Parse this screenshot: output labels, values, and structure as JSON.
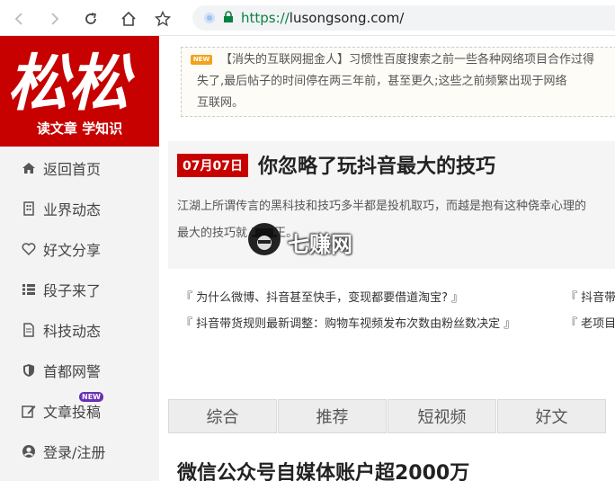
{
  "browser": {
    "url_scheme": "https://",
    "url_rest": "lusongsong.com/"
  },
  "sidebar": {
    "logo_text": "松松",
    "tagline": "读文章 学知识",
    "items": [
      {
        "label": "返回首页",
        "icon": "home-icon"
      },
      {
        "label": "业界动态",
        "icon": "building-icon"
      },
      {
        "label": "好文分享",
        "icon": "heart-icon"
      },
      {
        "label": "段子来了",
        "icon": "list-icon"
      },
      {
        "label": "科技动态",
        "icon": "document-icon"
      },
      {
        "label": "首都网警",
        "icon": "shield-icon"
      },
      {
        "label": "文章投稿",
        "icon": "edit-icon",
        "badge": "NEW"
      },
      {
        "label": "登录/注册",
        "icon": "user-icon"
      }
    ]
  },
  "notice": {
    "badge": "NEW",
    "line1": "【消失的互联网掘金人】习惯性百度搜索之前一些各种网络项目合作过得",
    "line2": "失了,最后帖子的时间停在两三年前，甚至更久;这些之前频繁出现于网络",
    "line3": "互联网。"
  },
  "feature": {
    "date": "07月07日",
    "title": "你忽略了玩抖音最大的技巧",
    "desc_line1": "江湖上所谓传言的黑科技和技巧多半都是投机取巧，而越是抱有这种侥幸心理的",
    "desc_line2": "最大的技巧就         容为王。"
  },
  "links": {
    "row1_left": "『 为什么微博、抖音甚至快手，变现都要借道淘宝? 』",
    "row1_right": "『 抖音带",
    "row2_left": "『 抖音带货规则最新调整：购物车视频发布次数由粉丝数决定 』",
    "row2_right": "『 老项目"
  },
  "tabs": [
    "综合",
    "推荐",
    "短视频",
    "好文"
  ],
  "article": {
    "title": "微信公众号自媒体账户超2000万"
  },
  "watermark": {
    "text": "七赚网"
  }
}
